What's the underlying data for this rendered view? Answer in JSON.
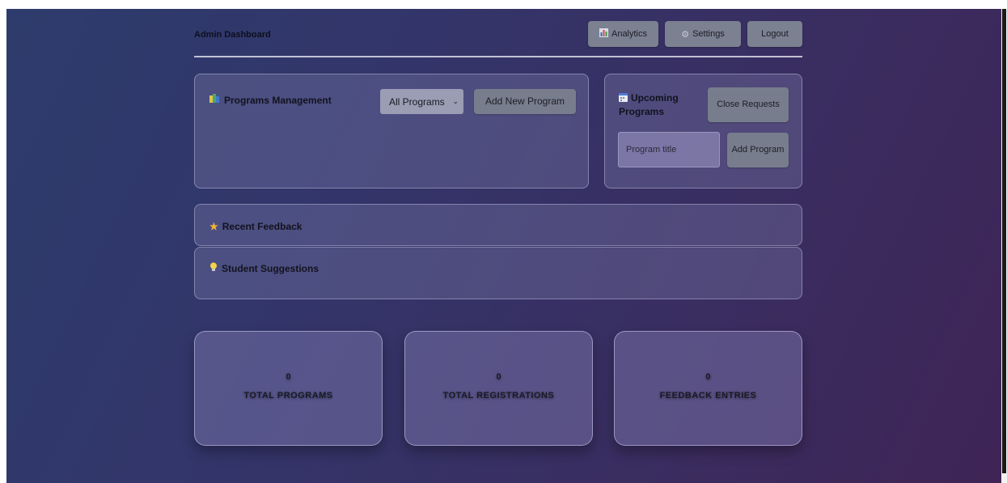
{
  "header": {
    "title": "Admin Dashboard",
    "analytics": {
      "icon": "bar-chart-icon",
      "label": "Analytics"
    },
    "settings": {
      "icon": "gear-icon",
      "label": "Settings"
    },
    "logout": {
      "label": "Logout"
    }
  },
  "programs": {
    "icon": "books-icon",
    "title": "Programs Management",
    "filter": {
      "selected": "All Programs"
    },
    "add_button": "Add New Program"
  },
  "upcoming": {
    "icon": "calendar-icon",
    "title": "Upcoming Programs",
    "close_requests": "Close Requests",
    "input_placeholder": "Program title",
    "add_button": "Add Program"
  },
  "feedback": {
    "icon": "star-icon",
    "title": "Recent Feedback"
  },
  "suggestions": {
    "icon": "lightbulb-icon",
    "title": "Student Suggestions"
  },
  "stats": [
    {
      "value": "0",
      "label": "TOTAL PROGRAMS"
    },
    {
      "value": "0",
      "label": "TOTAL REGISTRATIONS"
    },
    {
      "value": "0",
      "label": "FEEDBACK ENTRIES"
    }
  ],
  "colors": {
    "accent_button": "#777d8c",
    "background_start": "#2d3c6c",
    "background_end": "#3f2456"
  }
}
